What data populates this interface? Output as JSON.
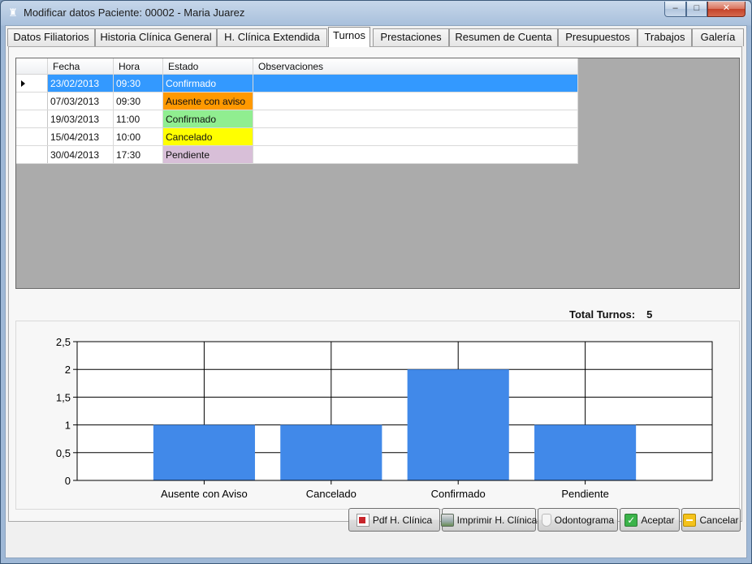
{
  "window": {
    "title": "Modificar datos Paciente: 00002 - Maria Juarez",
    "controls": {
      "minimize": "–",
      "maximize": "□",
      "close": "✕"
    }
  },
  "tabs": [
    {
      "label": "Datos Filiatorios",
      "active": false
    },
    {
      "label": "Historia Clínica General",
      "active": false
    },
    {
      "label": "H. Clínica Extendida",
      "active": false
    },
    {
      "label": "Turnos",
      "active": true
    },
    {
      "label": "Prestaciones",
      "active": false
    },
    {
      "label": "Resumen de Cuenta",
      "active": false
    },
    {
      "label": "Presupuestos",
      "active": false
    },
    {
      "label": "Trabajos",
      "active": false
    },
    {
      "label": "Galería",
      "active": false
    }
  ],
  "grid": {
    "columns": [
      "Fecha",
      "Hora",
      "Estado",
      "Observaciones"
    ],
    "rows": [
      {
        "fecha": "23/02/2013",
        "hora": "09:30",
        "estado": "Confirmado",
        "observaciones": "",
        "color": "#3399ff",
        "selected": true
      },
      {
        "fecha": "07/03/2013",
        "hora": "09:30",
        "estado": "Ausente con aviso",
        "observaciones": "",
        "color": "#ff9900",
        "selected": false
      },
      {
        "fecha": "19/03/2013",
        "hora": "11:00",
        "estado": "Confirmado",
        "observaciones": "",
        "color": "#90ee90",
        "selected": false
      },
      {
        "fecha": "15/04/2013",
        "hora": "10:00",
        "estado": "Cancelado",
        "observaciones": "",
        "color": "#ffff00",
        "selected": false
      },
      {
        "fecha": "30/04/2013",
        "hora": "17:30",
        "estado": "Pendiente",
        "observaciones": "",
        "color": "#d8bfd8",
        "selected": false
      }
    ]
  },
  "total": {
    "label": "Total Turnos:",
    "value": "5"
  },
  "chart_data": {
    "type": "bar",
    "categories": [
      "Ausente con Aviso",
      "Cancelado",
      "Confirmado",
      "Pendiente"
    ],
    "values": [
      1,
      1,
      2,
      1
    ],
    "ylim": [
      0,
      2.5
    ],
    "yticks": [
      "0",
      "0,5",
      "1",
      "1,5",
      "2",
      "2,5"
    ],
    "grid": true,
    "bar_color": "#4189e9"
  },
  "buttons": {
    "pdf": {
      "label": "Pdf H. Clínica",
      "icon": "pdf-icon"
    },
    "print": {
      "label": "Imprimir H. Clínica",
      "icon": "printer-icon"
    },
    "odontograma": {
      "label": "Odontograma",
      "icon": "tooth-icon"
    },
    "aceptar": {
      "label": "Aceptar",
      "icon": "check-icon"
    },
    "cancelar": {
      "label": "Cancelar",
      "icon": "cancel-icon"
    }
  }
}
